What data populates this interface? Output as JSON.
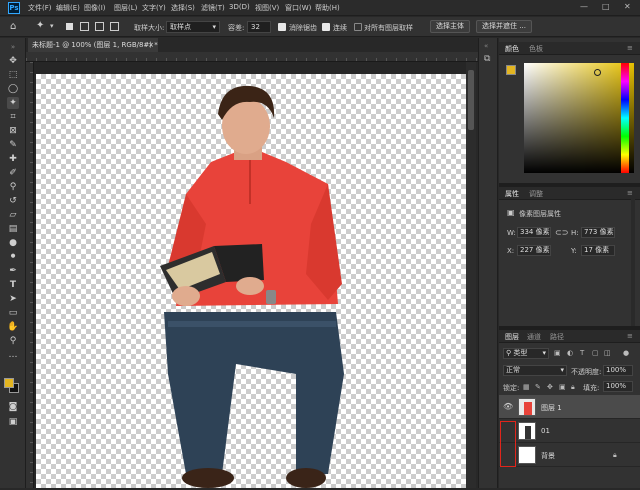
{
  "app": {
    "logo": "Ps"
  },
  "menu": [
    "文件(F)",
    "编辑(E)",
    "图像(I)",
    "图层(L)",
    "文字(Y)",
    "选择(S)",
    "滤镜(T)",
    "3D(D)",
    "视图(V)",
    "窗口(W)",
    "帮助(H)"
  ],
  "window_controls": {
    "minimize": "—",
    "maximize": "□",
    "close": "✕"
  },
  "options": {
    "sample_size_label": "取样大小:",
    "sample_size_value": "取样点",
    "tolerance_label": "容差:",
    "tolerance_value": "32",
    "antialias_label": "消除锯齿",
    "contiguous_label": "连续",
    "sample_all_label": "对所有图层取样",
    "select_subject_label": "选择主体",
    "select_mask_label": "选择并遮住 ..."
  },
  "document": {
    "tab_title": "未标题-1 @ 100% (图层 1, RGB/8#) *",
    "tab_close": "×"
  },
  "color_panel": {
    "tabs": [
      "颜色",
      "色板"
    ],
    "foreground": "#e3b521",
    "background": "#111111"
  },
  "properties_panel": {
    "tabs": [
      "属性",
      "调整"
    ],
    "header": "像素图层属性",
    "w_label": "W:",
    "w_value": "334 像素",
    "h_label": "H:",
    "h_value": "773 像素",
    "x_label": "X:",
    "x_value": "227 像素",
    "y_label": "Y:",
    "y_value": "17 像素",
    "link_icon": "link-icon"
  },
  "layers_panel": {
    "tabs": [
      "图层",
      "通道",
      "路径"
    ],
    "filter_kind": "类型",
    "blend_mode": "正常",
    "opacity_label": "不透明度:",
    "opacity_value": "100%",
    "lock_label": "锁定:",
    "fill_label": "填充:",
    "fill_value": "100%",
    "layers": [
      {
        "name": "图层 1",
        "visible": true,
        "selected": true
      },
      {
        "name": "01",
        "visible": false,
        "selected": false
      },
      {
        "name": "背景",
        "visible": false,
        "selected": false,
        "locked": true
      }
    ]
  },
  "colors": {
    "accent": "#31a8ff",
    "highlight_box": "#e0251b"
  }
}
